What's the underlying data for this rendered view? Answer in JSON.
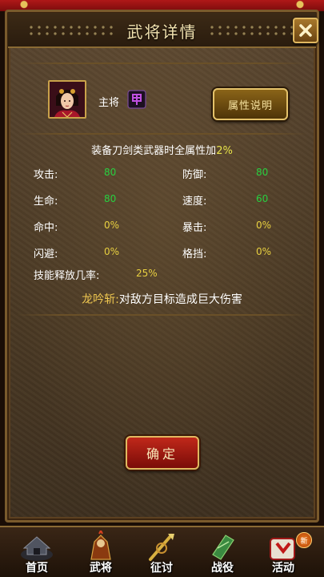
{
  "header": {
    "title": "武将详情"
  },
  "general": {
    "role": "主将",
    "attr_button": "属性说明"
  },
  "bonus_note": {
    "text": "装备刀剑类武器时全属性加",
    "value": "2%"
  },
  "stats": [
    {
      "label": "攻击:",
      "value": "80"
    },
    {
      "label": "防御:",
      "value": "80"
    },
    {
      "label": "生命:",
      "value": "80"
    },
    {
      "label": "速度:",
      "value": "60"
    },
    {
      "label": "命中:",
      "value": "0%"
    },
    {
      "label": "暴击:",
      "value": "0%"
    },
    {
      "label": "闪避:",
      "value": "0%"
    },
    {
      "label": "格挡:",
      "value": "0%"
    }
  ],
  "skill_rate": {
    "label": "技能释放几率:",
    "value": "25%"
  },
  "skill": {
    "name": "龙吟斩:",
    "desc": "对敌方目标造成巨大伤害"
  },
  "confirm_button": "确定",
  "nav": {
    "items": [
      {
        "label": "首页",
        "icon": "home-icon"
      },
      {
        "label": "武将",
        "icon": "general-icon"
      },
      {
        "label": "征讨",
        "icon": "campaign-icon"
      },
      {
        "label": "战役",
        "icon": "battle-icon"
      },
      {
        "label": "活动",
        "icon": "event-icon"
      }
    ],
    "badge": "新"
  },
  "colors": {
    "stat_green": "#28d040",
    "stat_yellow": "#e8d040",
    "title": "#f3e3b0"
  }
}
